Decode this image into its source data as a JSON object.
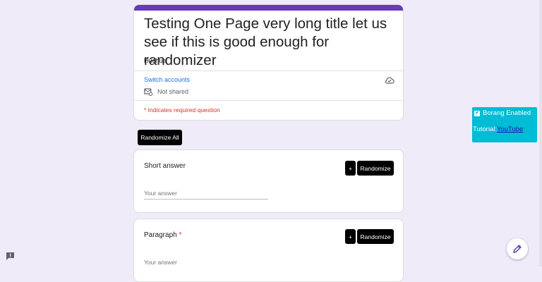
{
  "form": {
    "title": "Testing One Page very long title let us see if this is good enough for randomizer",
    "description": "Huehue",
    "switch_accounts": "Switch accounts",
    "sharing_status": "Not shared",
    "required_note": "* Indicates required question",
    "accent_color": "#673ab7"
  },
  "toolbar": {
    "randomize_all": "Randomize All"
  },
  "questions": [
    {
      "title": "Short answer",
      "required": false,
      "plus_label": "+",
      "randomize_label": "Randomize",
      "placeholder": "Your answer"
    },
    {
      "title": "Paragraph",
      "required": true,
      "required_mark": "*",
      "plus_label": "+",
      "randomize_label": "Randomize",
      "placeholder": "Your answer"
    }
  ],
  "extension": {
    "checkbox_label": "Borang Enabled",
    "checkbox_checked": true,
    "tutorial_label": "Tutorial:",
    "tutorial_link": "YouTube",
    "panel_color": "#00bcd4"
  },
  "icons": {
    "cloud": "cloud-icon",
    "mail": "mail-icon",
    "feedback": "feedback-icon",
    "edit": "pencil-icon"
  }
}
